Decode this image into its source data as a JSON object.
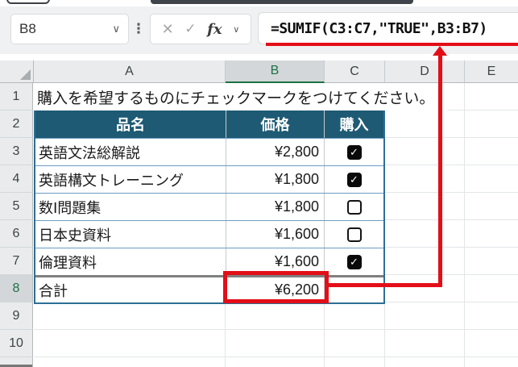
{
  "name_box": {
    "value": "B8"
  },
  "formula_bar": {
    "formula": "=SUMIF(C3:C7,\"TRUE\",B3:B7)",
    "fx_label": "fx"
  },
  "icons": {
    "cancel": "✕",
    "enter": "✓",
    "check": "✓",
    "chevron_down": "∨",
    "more_dots": "⋮"
  },
  "grid": {
    "column_headers": [
      "A",
      "B",
      "C",
      "D",
      "E"
    ],
    "row_headers": [
      "1",
      "2",
      "3",
      "4",
      "5",
      "6",
      "7",
      "8",
      "9",
      "10"
    ],
    "selected_column": "B",
    "selected_row": "8",
    "active_cell": "B8"
  },
  "sheet": {
    "instruction": "購入を希望するものにチェックマークをつけてください。",
    "table": {
      "headers": [
        "品名",
        "価格",
        "購入"
      ],
      "rows": [
        {
          "name": "英語文法総解説",
          "price": "¥2,800",
          "checked": true
        },
        {
          "name": "英語構文トレーニング",
          "price": "¥1,800",
          "checked": true
        },
        {
          "name": "数Ⅰ問題集",
          "price": "¥1,800",
          "checked": false
        },
        {
          "name": "日本史資料",
          "price": "¥1,600",
          "checked": false
        },
        {
          "name": "倫理資料",
          "price": "¥1,600",
          "checked": true
        }
      ],
      "total_label": "合計",
      "total_value": "¥6,200"
    }
  },
  "colors": {
    "table_header_bg": "#1E5A74",
    "table_border_blue": "#2E6E96",
    "row_rule_blue": "#6D9CC4",
    "thick_rule_gray": "#7F7F7F",
    "selection_green": "#1E7145",
    "annotation_red": "#E30E17",
    "formula_bar_bg": "#EFF1F3"
  }
}
